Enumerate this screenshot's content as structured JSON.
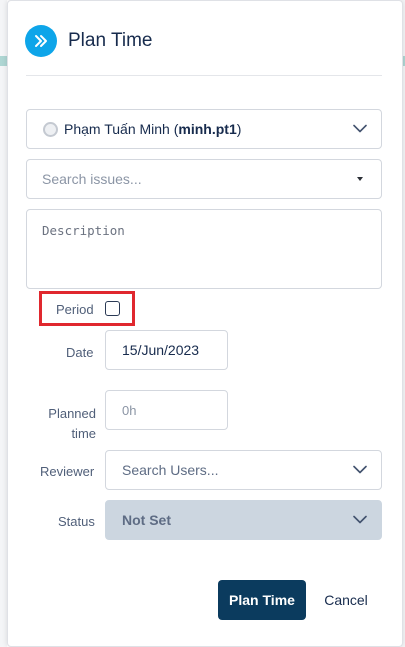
{
  "dialog": {
    "title": "Plan Time",
    "header_icon": "double-chevron-right-icon",
    "accent_color": "#0ea5e9"
  },
  "user": {
    "name": "Phạm Tuấn Minh",
    "username": "minh.pt1"
  },
  "issues": {
    "placeholder": "Search issues..."
  },
  "description": {
    "placeholder": "Description"
  },
  "period": {
    "label": "Period",
    "checked": false
  },
  "date": {
    "label": "Date",
    "value": "15/Jun/2023"
  },
  "planned_time": {
    "label": "Planned time",
    "placeholder": "0h"
  },
  "reviewer": {
    "label": "Reviewer",
    "placeholder": "Search Users..."
  },
  "status": {
    "label": "Status",
    "value": "Not Set"
  },
  "actions": {
    "primary_label": "Plan Time",
    "cancel_label": "Cancel",
    "primary_color": "#0b3b5e"
  },
  "highlight_color": "#e0282e"
}
